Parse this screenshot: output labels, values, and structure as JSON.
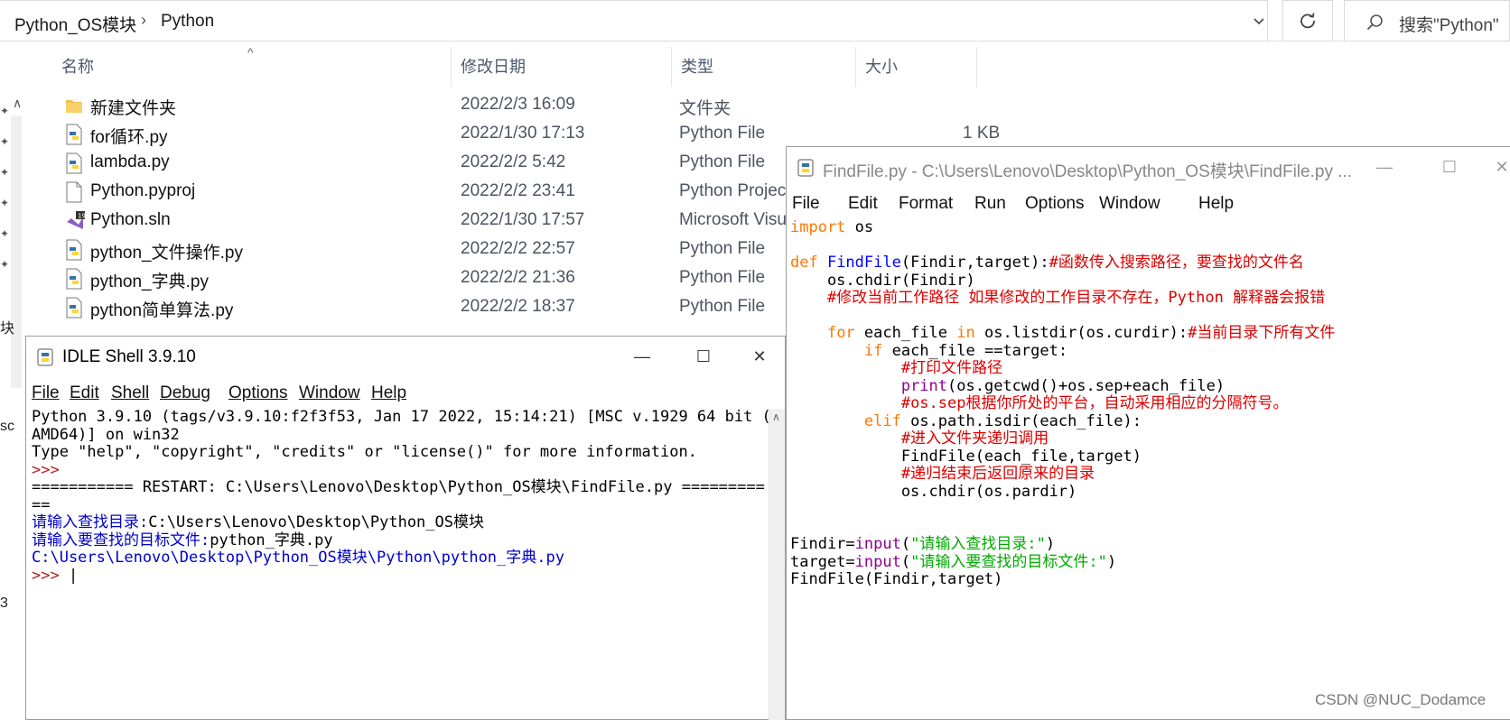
{
  "explorer": {
    "breadcrumb": [
      "Python_OS模块",
      "Python"
    ],
    "search_placeholder": "搜索\"Python\"",
    "nav_fragments": [
      "块",
      "sc",
      "3"
    ],
    "columns": {
      "name": "名称",
      "date": "修改日期",
      "type": "类型",
      "size": "大小"
    },
    "files": [
      {
        "icon": "folder-icon",
        "name": "新建文件夹",
        "date": "2022/2/3 16:09",
        "type": "文件夹",
        "size": ""
      },
      {
        "icon": "python-file-icon",
        "name": "for循环.py",
        "date": "2022/1/30 17:13",
        "type": "Python File",
        "size": "1 KB"
      },
      {
        "icon": "python-file-icon",
        "name": "lambda.py",
        "date": "2022/2/2 5:42",
        "type": "Python File",
        "size": ""
      },
      {
        "icon": "blank-file-icon",
        "name": "Python.pyproj",
        "date": "2022/2/2 23:41",
        "type": "Python Projec",
        "size": ""
      },
      {
        "icon": "visual-studio-solution-icon",
        "name": "Python.sln",
        "date": "2022/1/30 17:57",
        "type": "Microsoft Visu",
        "size": ""
      },
      {
        "icon": "python-file-icon",
        "name": "python_文件操作.py",
        "date": "2022/2/2 22:57",
        "type": "Python File",
        "size": ""
      },
      {
        "icon": "python-file-icon",
        "name": "python_字典.py",
        "date": "2022/2/2 21:36",
        "type": "Python File",
        "size": ""
      },
      {
        "icon": "python-file-icon",
        "name": "python简单算法.py",
        "date": "2022/2/2 18:37",
        "type": "Python File",
        "size": ""
      }
    ]
  },
  "editor": {
    "title": "FindFile.py - C:\\Users\\Lenovo\\Desktop\\Python_OS模块\\FindFile.py ...",
    "menu": [
      "File",
      "Edit",
      "Format",
      "Run",
      "Options",
      "Window",
      "Help"
    ],
    "code": [
      [
        [
          "kw",
          "import"
        ],
        [
          "blk",
          " os"
        ]
      ],
      [],
      [
        [
          "kw",
          "def "
        ],
        [
          "def",
          "FindFile"
        ],
        [
          "blk",
          "(Findir,target):"
        ],
        [
          "com",
          "#函数传入搜索路径，要查找的文件名"
        ]
      ],
      [
        [
          "blk",
          "    os.chdir(Findir)"
        ]
      ],
      [
        [
          "blk",
          "    "
        ],
        [
          "com",
          "#修改当前工作路径 如果修改的工作目录不存在，Python 解释器会报错"
        ]
      ],
      [],
      [
        [
          "blk",
          "    "
        ],
        [
          "kw",
          "for"
        ],
        [
          "blk",
          " each_file "
        ],
        [
          "kw",
          "in"
        ],
        [
          "blk",
          " os.listdir(os.curdir):"
        ],
        [
          "com",
          "#当前目录下所有文件"
        ]
      ],
      [
        [
          "blk",
          "        "
        ],
        [
          "kw",
          "if"
        ],
        [
          "blk",
          " each_file ==target:"
        ]
      ],
      [
        [
          "blk",
          "            "
        ],
        [
          "com",
          "#打印文件路径"
        ]
      ],
      [
        [
          "blk",
          "            "
        ],
        [
          "bi",
          "print"
        ],
        [
          "blk",
          "(os.getcwd()+os.sep+each_file)"
        ]
      ],
      [
        [
          "blk",
          "            "
        ],
        [
          "com",
          "#os.sep根据你所处的平台，自动采用相应的分隔符号。"
        ]
      ],
      [
        [
          "blk",
          "        "
        ],
        [
          "kw",
          "elif"
        ],
        [
          "blk",
          " os.path.isdir(each_file):"
        ]
      ],
      [
        [
          "blk",
          "            "
        ],
        [
          "com",
          "#进入文件夹递归调用"
        ]
      ],
      [
        [
          "blk",
          "            FindFile(each_file,target)"
        ]
      ],
      [
        [
          "blk",
          "            "
        ],
        [
          "com",
          "#递归结束后返回原来的目录"
        ]
      ],
      [
        [
          "blk",
          "            os.chdir(os.pardir)"
        ]
      ],
      [],
      [],
      [
        [
          "blk",
          "Findir="
        ],
        [
          "bi",
          "input"
        ],
        [
          "blk",
          "("
        ],
        [
          "str",
          "\"请输入查找目录:\""
        ],
        [
          "blk",
          ")"
        ]
      ],
      [
        [
          "blk",
          "target="
        ],
        [
          "bi",
          "input"
        ],
        [
          "blk",
          "("
        ],
        [
          "str",
          "\"请输入要查找的目标文件:\""
        ],
        [
          "blk",
          ")"
        ]
      ],
      [
        [
          "blk",
          "FindFile(Findir,target)"
        ]
      ]
    ]
  },
  "shell": {
    "title": "IDLE Shell 3.9.10",
    "menu": [
      "File",
      "Edit",
      "Shell",
      "Debug",
      "Options",
      "Window",
      "Help"
    ],
    "lines": [
      [
        [
          "blk",
          "Python 3.9.10 (tags/v3.9.10:f2f3f53, Jan 17 2022, 15:14:21) [MSC v.1929 64 bit ("
        ]
      ],
      [
        [
          "blk",
          "AMD64)] on win32"
        ]
      ],
      [
        [
          "blk",
          "Type \"help\", \"copyright\", \"credits\" or \"license()\" for more information."
        ]
      ],
      [
        [
          "prm",
          ">>>"
        ]
      ],
      [
        [
          "blk",
          "=========== RESTART: C:\\Users\\Lenovo\\Desktop\\Python_OS模块\\FindFile.py ========="
        ]
      ],
      [
        [
          "blk",
          "=="
        ]
      ],
      [
        [
          "out",
          "请输入查找目录:"
        ],
        [
          "blk",
          "C:\\Users\\Lenovo\\Desktop\\Python_OS模块"
        ]
      ],
      [
        [
          "out",
          "请输入要查找的目标文件:"
        ],
        [
          "blk",
          "python_字典.py"
        ]
      ],
      [
        [
          "out",
          "C:\\Users\\Lenovo\\Desktop\\Python_OS模块\\Python\\python_字典.py"
        ]
      ],
      [
        [
          "prm",
          ">>> "
        ],
        [
          "blk",
          "|"
        ]
      ]
    ]
  },
  "watermark": "CSDN @NUC_Dodamce"
}
